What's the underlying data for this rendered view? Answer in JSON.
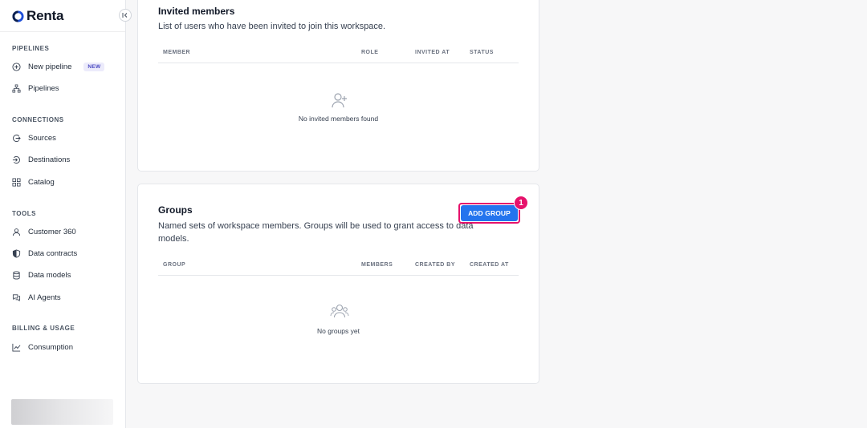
{
  "brand": {
    "name": "Renta"
  },
  "sidebar": {
    "collapse_icon": "collapse-left-icon",
    "sections": [
      {
        "title": "PIPELINES",
        "items": [
          {
            "label": "New pipeline",
            "icon": "plus-circle-icon",
            "badge": "NEW"
          },
          {
            "label": "Pipelines",
            "icon": "pipelines-icon"
          }
        ]
      },
      {
        "title": "CONNECTIONS",
        "items": [
          {
            "label": "Sources",
            "icon": "source-icon"
          },
          {
            "label": "Destinations",
            "icon": "destination-icon"
          },
          {
            "label": "Catalog",
            "icon": "grid-icon"
          }
        ]
      },
      {
        "title": "TOOLS",
        "items": [
          {
            "label": "Customer 360",
            "icon": "user-icon"
          },
          {
            "label": "Data contracts",
            "icon": "shield-icon"
          },
          {
            "label": "Data models",
            "icon": "database-icon"
          },
          {
            "label": "AI Agents",
            "icon": "chat-icon"
          }
        ]
      },
      {
        "title": "BILLING & USAGE",
        "items": [
          {
            "label": "Consumption",
            "icon": "chart-icon"
          }
        ]
      }
    ]
  },
  "invited": {
    "title": "Invited members",
    "description": "List of users who have been invited to join this workspace.",
    "columns": [
      "MEMBER",
      "ROLE",
      "INVITED AT",
      "STATUS"
    ],
    "empty_text": "No invited members found",
    "empty_icon": "user-plus-icon"
  },
  "groups": {
    "title": "Groups",
    "description_line1": "Named sets of workspace members. Groups will be used to grant access to data",
    "description_line2": "models.",
    "add_button": "ADD GROUP",
    "step_marker": "1",
    "columns": [
      "GROUP",
      "MEMBERS",
      "CREATED BY",
      "CREATED AT"
    ],
    "empty_text": "No groups yet",
    "empty_icon": "users-icon"
  },
  "colors": {
    "primary": "#2374ee",
    "highlight": "#e6126b",
    "badge_bg": "#ecebfb",
    "badge_fg": "#4b4ac2"
  }
}
